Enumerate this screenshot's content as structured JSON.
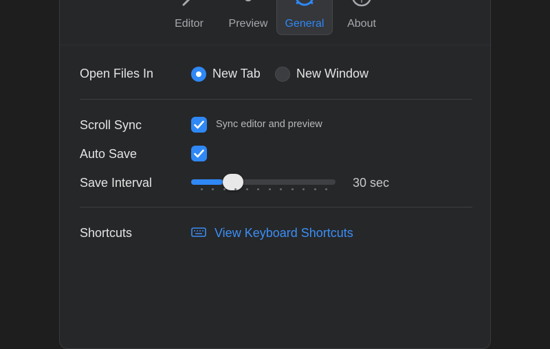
{
  "tabs": [
    {
      "label": "Editor",
      "icon": "pencil-icon",
      "active": false
    },
    {
      "label": "Preview",
      "icon": "eye-icon",
      "active": false
    },
    {
      "label": "General",
      "icon": "gear-icon",
      "active": true
    },
    {
      "label": "About",
      "icon": "info-icon",
      "active": false
    }
  ],
  "open_files": {
    "label": "Open Files In",
    "options": [
      {
        "label": "New Tab",
        "selected": true
      },
      {
        "label": "New Window",
        "selected": false
      }
    ]
  },
  "scroll_sync": {
    "label": "Scroll Sync",
    "checked": true,
    "description": "Sync editor and preview"
  },
  "auto_save": {
    "label": "Auto Save",
    "checked": true
  },
  "save_interval": {
    "label": "Save Interval",
    "value_text": "30 sec",
    "fraction": 0.22,
    "ticks": 12
  },
  "shortcuts": {
    "label": "Shortcuts",
    "link": "View Keyboard Shortcuts",
    "icon": "keyboard-icon"
  },
  "colors": {
    "accent": "#2f88f5",
    "background": "#262729"
  }
}
